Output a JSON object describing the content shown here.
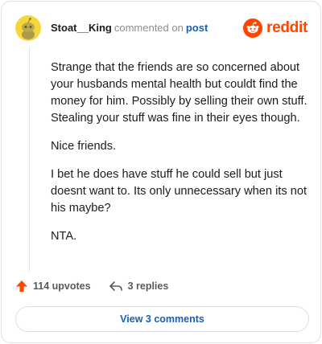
{
  "header": {
    "username": "Stoat__King",
    "action": "commented on",
    "post_link": "post",
    "brand": "reddit"
  },
  "comment": {
    "paragraphs": [
      "Strange that the friends are so concerned about your husbands mental health but couldt find the money for him. Possibly by selling their own stuff. Stealing your stuff was fine in their eyes though.",
      "Nice friends.",
      "I bet he does have stuff he could sell but just doesnt want to. Its only unnecessary when its not his maybe?",
      "NTA."
    ]
  },
  "footer": {
    "upvotes": "114 upvotes",
    "replies": "3 replies"
  },
  "view_comments_label": "View 3 comments",
  "colors": {
    "brand": "#ff4500",
    "link": "#1a5fb4",
    "upvote": "#ff4500",
    "avatar_bg": "#f5d63b"
  },
  "icons": {
    "avatar": "snoo-avatar-icon",
    "brand": "reddit-logo-icon",
    "upvote": "upvote-arrow-icon",
    "replies": "reply-arrow-icon"
  }
}
